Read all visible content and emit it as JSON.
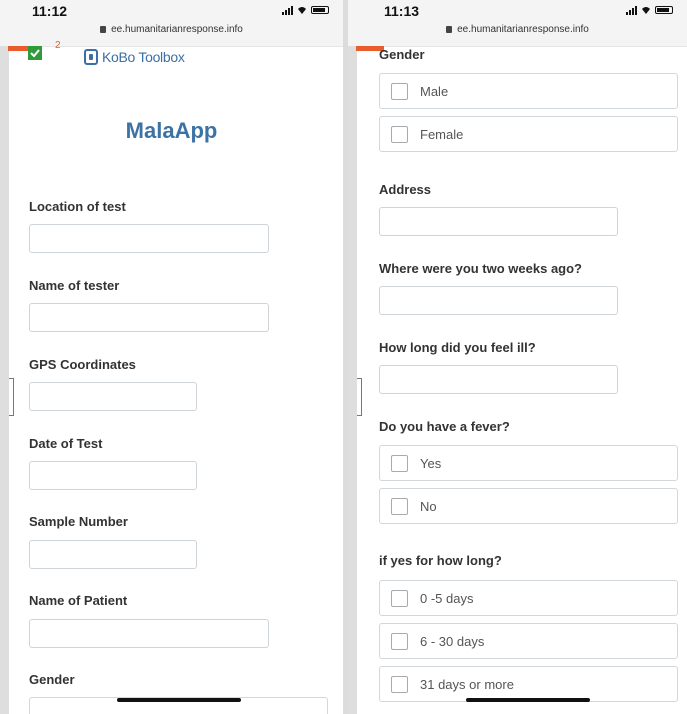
{
  "left_screen": {
    "status": {
      "time": "11:12",
      "url": "ee.humanitarianresponse.info"
    },
    "brand": {
      "logo_text": "KoBo Toolbox",
      "badge": "2"
    },
    "form_title": "MalaApp",
    "fields": [
      {
        "label": "Location of test",
        "value": ""
      },
      {
        "label": "Name of tester",
        "value": ""
      },
      {
        "label": "GPS Coordinates",
        "value": ""
      },
      {
        "label": "Date of Test",
        "value": ""
      },
      {
        "label": "Sample Number",
        "value": ""
      },
      {
        "label": "Name of Patient",
        "value": ""
      }
    ],
    "gender_label": "Gender"
  },
  "right_screen": {
    "status": {
      "time": "11:13",
      "url": "ee.humanitarianresponse.info"
    },
    "gender": {
      "label": "Gender",
      "options": [
        "Male",
        "Female"
      ]
    },
    "fields": [
      {
        "label": "Address",
        "value": ""
      },
      {
        "label": "Where were you two weeks ago?",
        "value": ""
      },
      {
        "label": "How long did you feel ill?",
        "value": ""
      }
    ],
    "fever": {
      "label": "Do you have a fever?",
      "options": [
        "Yes",
        "No"
      ]
    },
    "duration": {
      "label": "if yes for how long?",
      "options": [
        "0 -5 days",
        "6 - 30 days",
        "31 days or more"
      ]
    }
  },
  "colors": {
    "title_blue": "#3d72a4",
    "logo_blue": "#3c6fa3",
    "accent_orange": "#e85d2b",
    "check_green": "#2e9a3c",
    "label_text": "#333333"
  },
  "icons": [
    "lock-icon",
    "signal-icon",
    "wifi-icon",
    "battery-icon",
    "kobo-logo-icon",
    "check-icon",
    "checkbox-icon"
  ]
}
